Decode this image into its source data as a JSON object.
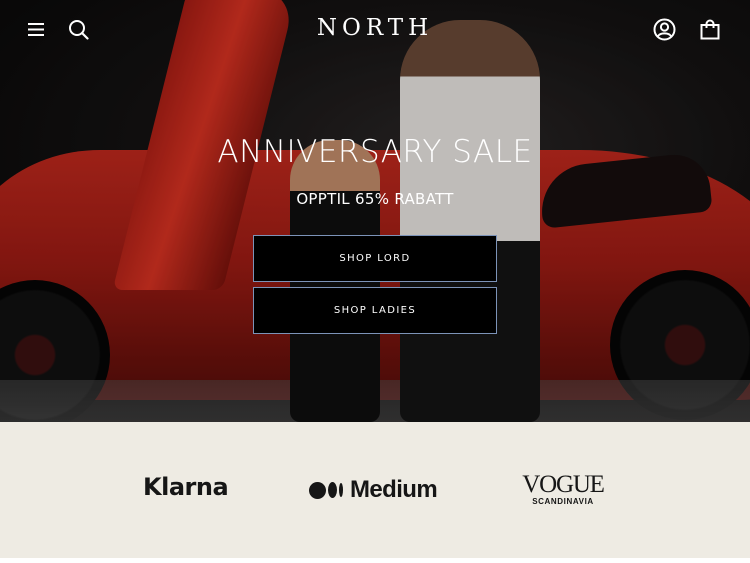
{
  "header": {
    "logo_text": "NORTH",
    "icons": {
      "menu": "hamburger-menu-icon",
      "search": "search-icon",
      "account": "account-icon",
      "cart": "shopping-bag-icon"
    }
  },
  "hero": {
    "title": "ANNIVERSARY SALE",
    "subtitle": "OPPTIL 65% RABATT",
    "buttons": {
      "shop_lord": "SHOP LORD",
      "shop_ladies": "SHOP LADIES"
    }
  },
  "press": {
    "klarna": "Klarna",
    "medium": "Medium",
    "vogue_main": "VOGUE",
    "vogue_sub": "SCANDINAVIA"
  },
  "colors": {
    "press_background": "#eeebe3",
    "button_background": "#000000",
    "button_border": "#7c93b8",
    "car_red": "#c92a1e"
  }
}
